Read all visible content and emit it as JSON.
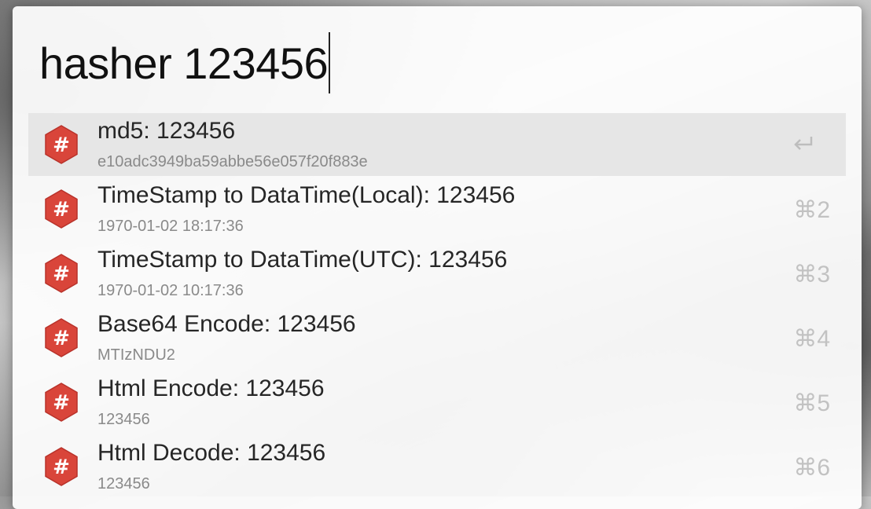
{
  "search": {
    "query": "hasher 123456"
  },
  "results": [
    {
      "title": "md5: 123456",
      "subtitle": "e10adc3949ba59abbe56e057f20f883e",
      "shortcut": "",
      "selected": true,
      "icon": "hash-icon"
    },
    {
      "title": "TimeStamp to DataTime(Local): 123456",
      "subtitle": "1970-01-02 18:17:36",
      "shortcut": "⌘2",
      "icon": "hash-icon"
    },
    {
      "title": "TimeStamp to DataTime(UTC): 123456",
      "subtitle": "1970-01-02 10:17:36",
      "shortcut": "⌘3",
      "icon": "hash-icon"
    },
    {
      "title": "Base64 Encode: 123456",
      "subtitle": "MTIzNDU2",
      "shortcut": "⌘4",
      "icon": "hash-icon"
    },
    {
      "title": "Html Encode: 123456",
      "subtitle": "123456",
      "shortcut": "⌘5",
      "icon": "hash-icon"
    },
    {
      "title": "Html Decode: 123456",
      "subtitle": "123456",
      "shortcut": "⌘6",
      "icon": "hash-icon"
    }
  ],
  "colors": {
    "icon_red": "#d9453a",
    "icon_red_dark": "#b8322a",
    "selected_bg": "#e6e6e6"
  }
}
